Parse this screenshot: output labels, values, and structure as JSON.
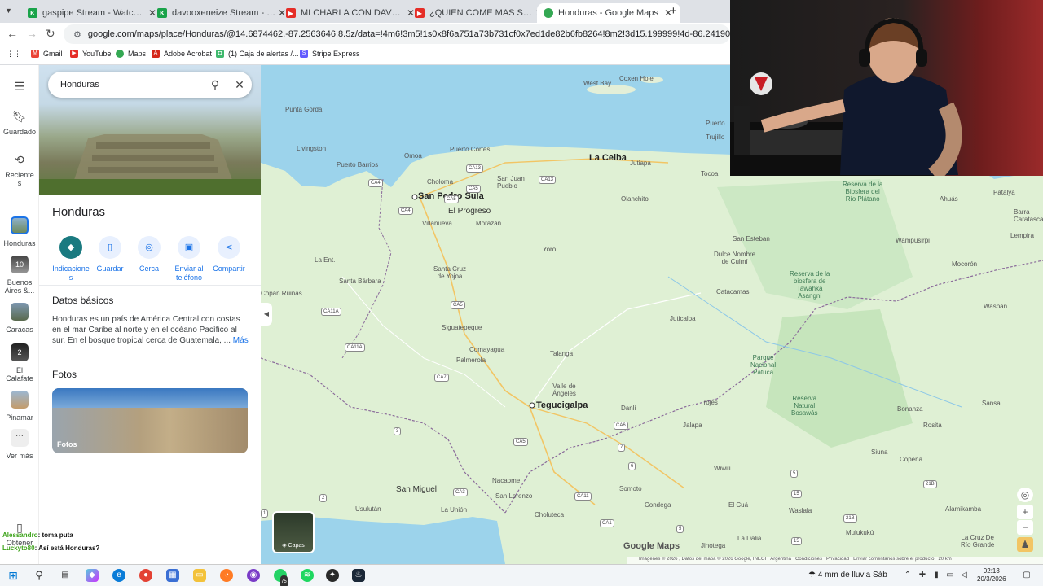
{
  "browser": {
    "tabs": [
      {
        "title": "gaspipe Stream - Watch Live o",
        "icon": "kick-icon",
        "active": false
      },
      {
        "title": "davooxeneize Stream - Watch L",
        "icon": "kick-icon",
        "active": false
      },
      {
        "title": "MI CHARLA CON DAVO XENEIZ",
        "icon": "youtube-icon",
        "active": false
      },
      {
        "title": "¿QUIEN COME MAS SUSHI? M",
        "icon": "youtube-icon",
        "active": false
      },
      {
        "title": "Honduras - Google Maps",
        "icon": "maps-pin-icon",
        "active": true
      }
    ],
    "url": "google.com/maps/place/Honduras/@14.6874462,-87.2563646,8.5z/data=!4m6!3m5!1s0x8f6a751a73b731cf0x7ed1de82b6fb8264!8m2!3d15.199999!4d-86.241905!16zL20vMDNoMmM?entry=t",
    "bookmarks": [
      "Gmail",
      "YouTube",
      "Maps",
      "Adobe Acrobat",
      "(1) Caja de alertas /...",
      "Stripe Express"
    ]
  },
  "rail": {
    "items": [
      {
        "label": "Guardado",
        "icon": "bookmark-icon"
      },
      {
        "label": "Reciente\ns",
        "icon": "history-icon"
      },
      {
        "label": "Honduras",
        "icon": "place-thumb"
      },
      {
        "label": "Buenos\nAires &...",
        "icon": "place-thumb",
        "badge": "10"
      },
      {
        "label": "Caracas",
        "icon": "place-thumb"
      },
      {
        "label": "El\nCalafate",
        "icon": "place-thumb",
        "badge": "2"
      },
      {
        "label": "Pinamar",
        "icon": "place-thumb"
      },
      {
        "label": "Ver más",
        "icon": "more-icon"
      },
      {
        "label": "Obtener",
        "icon": "phone-icon"
      }
    ]
  },
  "panel": {
    "search_query": "Honduras",
    "title": "Honduras",
    "actions": [
      {
        "label": "Indicacione\ns",
        "icon": "directions-icon"
      },
      {
        "label": "Guardar",
        "icon": "bookmark-icon"
      },
      {
        "label": "Cerca",
        "icon": "nearby-icon"
      },
      {
        "label": "Enviar al\nteléfono",
        "icon": "send-to-phone-icon"
      },
      {
        "label": "Compartir",
        "icon": "share-icon"
      }
    ],
    "datos_title": "Datos básicos",
    "datos_text": "Honduras es un país de América Central con costas en el mar Caribe al norte y en el océano Pacífico al sur. En el bosque tropical cerca de Guatemala, ...",
    "mas": "Más",
    "fotos_title": "Fotos",
    "fotos_label": "Fotos"
  },
  "map": {
    "labels": {
      "west_bay": "West Bay",
      "coxen_hole": "Coxen Hole",
      "punta_gorda": "Punta Gorda",
      "puerto_cortes": "Puerto Cortés",
      "omoa": "Omoa",
      "la_ceiba": "La Ceiba",
      "livingston": "Livingston",
      "puerto_barrios": "Puerto Barrios",
      "jutiapa": "Jutiapa",
      "trujillo": "Trujillo",
      "puerto": "Puerto",
      "san_juan_pueblo": "San Juan\nPueblo",
      "choloma": "Choloma",
      "tocoa": "Tocoa",
      "san_pedro_sula": "San Pedro Sula",
      "olanchito": "Olanchito",
      "el_progreso": "El Progreso",
      "villanueva": "Villanueva",
      "morazan": "Morazán",
      "yoro": "Yoro",
      "san_esteban": "San Esteban",
      "dulce_nombre": "Dulce Nombre\nde Culmí",
      "la_ent": "La Ent.",
      "santa_cruz_yojoa": "Santa Cruz\nde Yojoa",
      "santa_barbara": "Santa Bárbara",
      "copan_ruinas": "Copán Ruinas",
      "catacamas": "Catacamas",
      "juticalpa": "Juticalpa",
      "siguatepeque": "Siguatepeque",
      "comayagua": "Comayagua",
      "talanga": "Talanga",
      "palmerola": "Palmerola",
      "valle_angeles": "Valle de\nÁngeles",
      "tegucigalpa": "Tegucigalpa",
      "danli": "Danlí",
      "trojes": "Trojes",
      "jalapa": "Jalapa",
      "wiwili": "Wiwilí",
      "san_miguel": "San Miguel",
      "nacaome": "Nacaome",
      "usulutan": "Usulután",
      "la_union": "La Unión",
      "san_lorenzo": "San Lorenzo",
      "choluteca": "Choluteca",
      "somoto": "Somoto",
      "conde": "Condega",
      "el_cua": "El Cuá",
      "la_dalia": "La Dalia",
      "jinotega": "Jinotega",
      "waslala": "Waslala",
      "mulukuku": "Mulukukú",
      "siuna": "Siuna",
      "copena": "Copena",
      "bonanza": "Bonanza",
      "rosita": "Rosita",
      "sansa": "Sansa",
      "alamikamba": "Alamikamba",
      "la_cruz": "La Cruz De\nRío Grande",
      "ahuas": "Ahuás",
      "wampusirpi": "Wampusirpi",
      "mocoron": "Mocorón",
      "waspan": "Waspan",
      "patalya": "Patalya",
      "barra": "Barra\nCaratasca",
      "lempira": "Lempira",
      "reserva_biosfera_rio_platano": "Reserva de la\nBiosfera del\nRío Plátano",
      "reserva_tawahka": "Reserva de la\nbiosfera de\nTawahka\nAsangni",
      "parque_patuca": "Parque\nNacional\nPatuca",
      "reserva_bosawas": "Reserva\nNatural\nBosawás"
    },
    "highways": [
      "CA13",
      "CA5",
      "CA13",
      "CA5",
      "CA4",
      "CA4",
      "CA11A",
      "CA11A",
      "CA5",
      "CA7",
      "CA6",
      "CA5",
      "CA11",
      "CA3",
      "CA1",
      "6",
      "7",
      "3",
      "2",
      "1",
      "5",
      "21B",
      "21B",
      "15",
      "5",
      "15"
    ],
    "layers_label": "Capas",
    "google_logo": "Google Maps",
    "attribution": [
      "Imágenes © 2026 , Datos del mapa © 2026 Google, INEGI",
      "Argentina",
      "Condiciones",
      "Privacidad",
      "Enviar comentarios sobre el producto",
      "20 km"
    ]
  },
  "chat": [
    {
      "user": "Alessandro",
      "message": ": toma puta"
    },
    {
      "user": "Luckyto80",
      "message": ": Así está Honduras?"
    }
  ],
  "taskbar": {
    "weather": "4 mm de lluvia Sáb",
    "time": "02:13",
    "date": "20/3/2026",
    "whatsapp_badge": "75"
  }
}
